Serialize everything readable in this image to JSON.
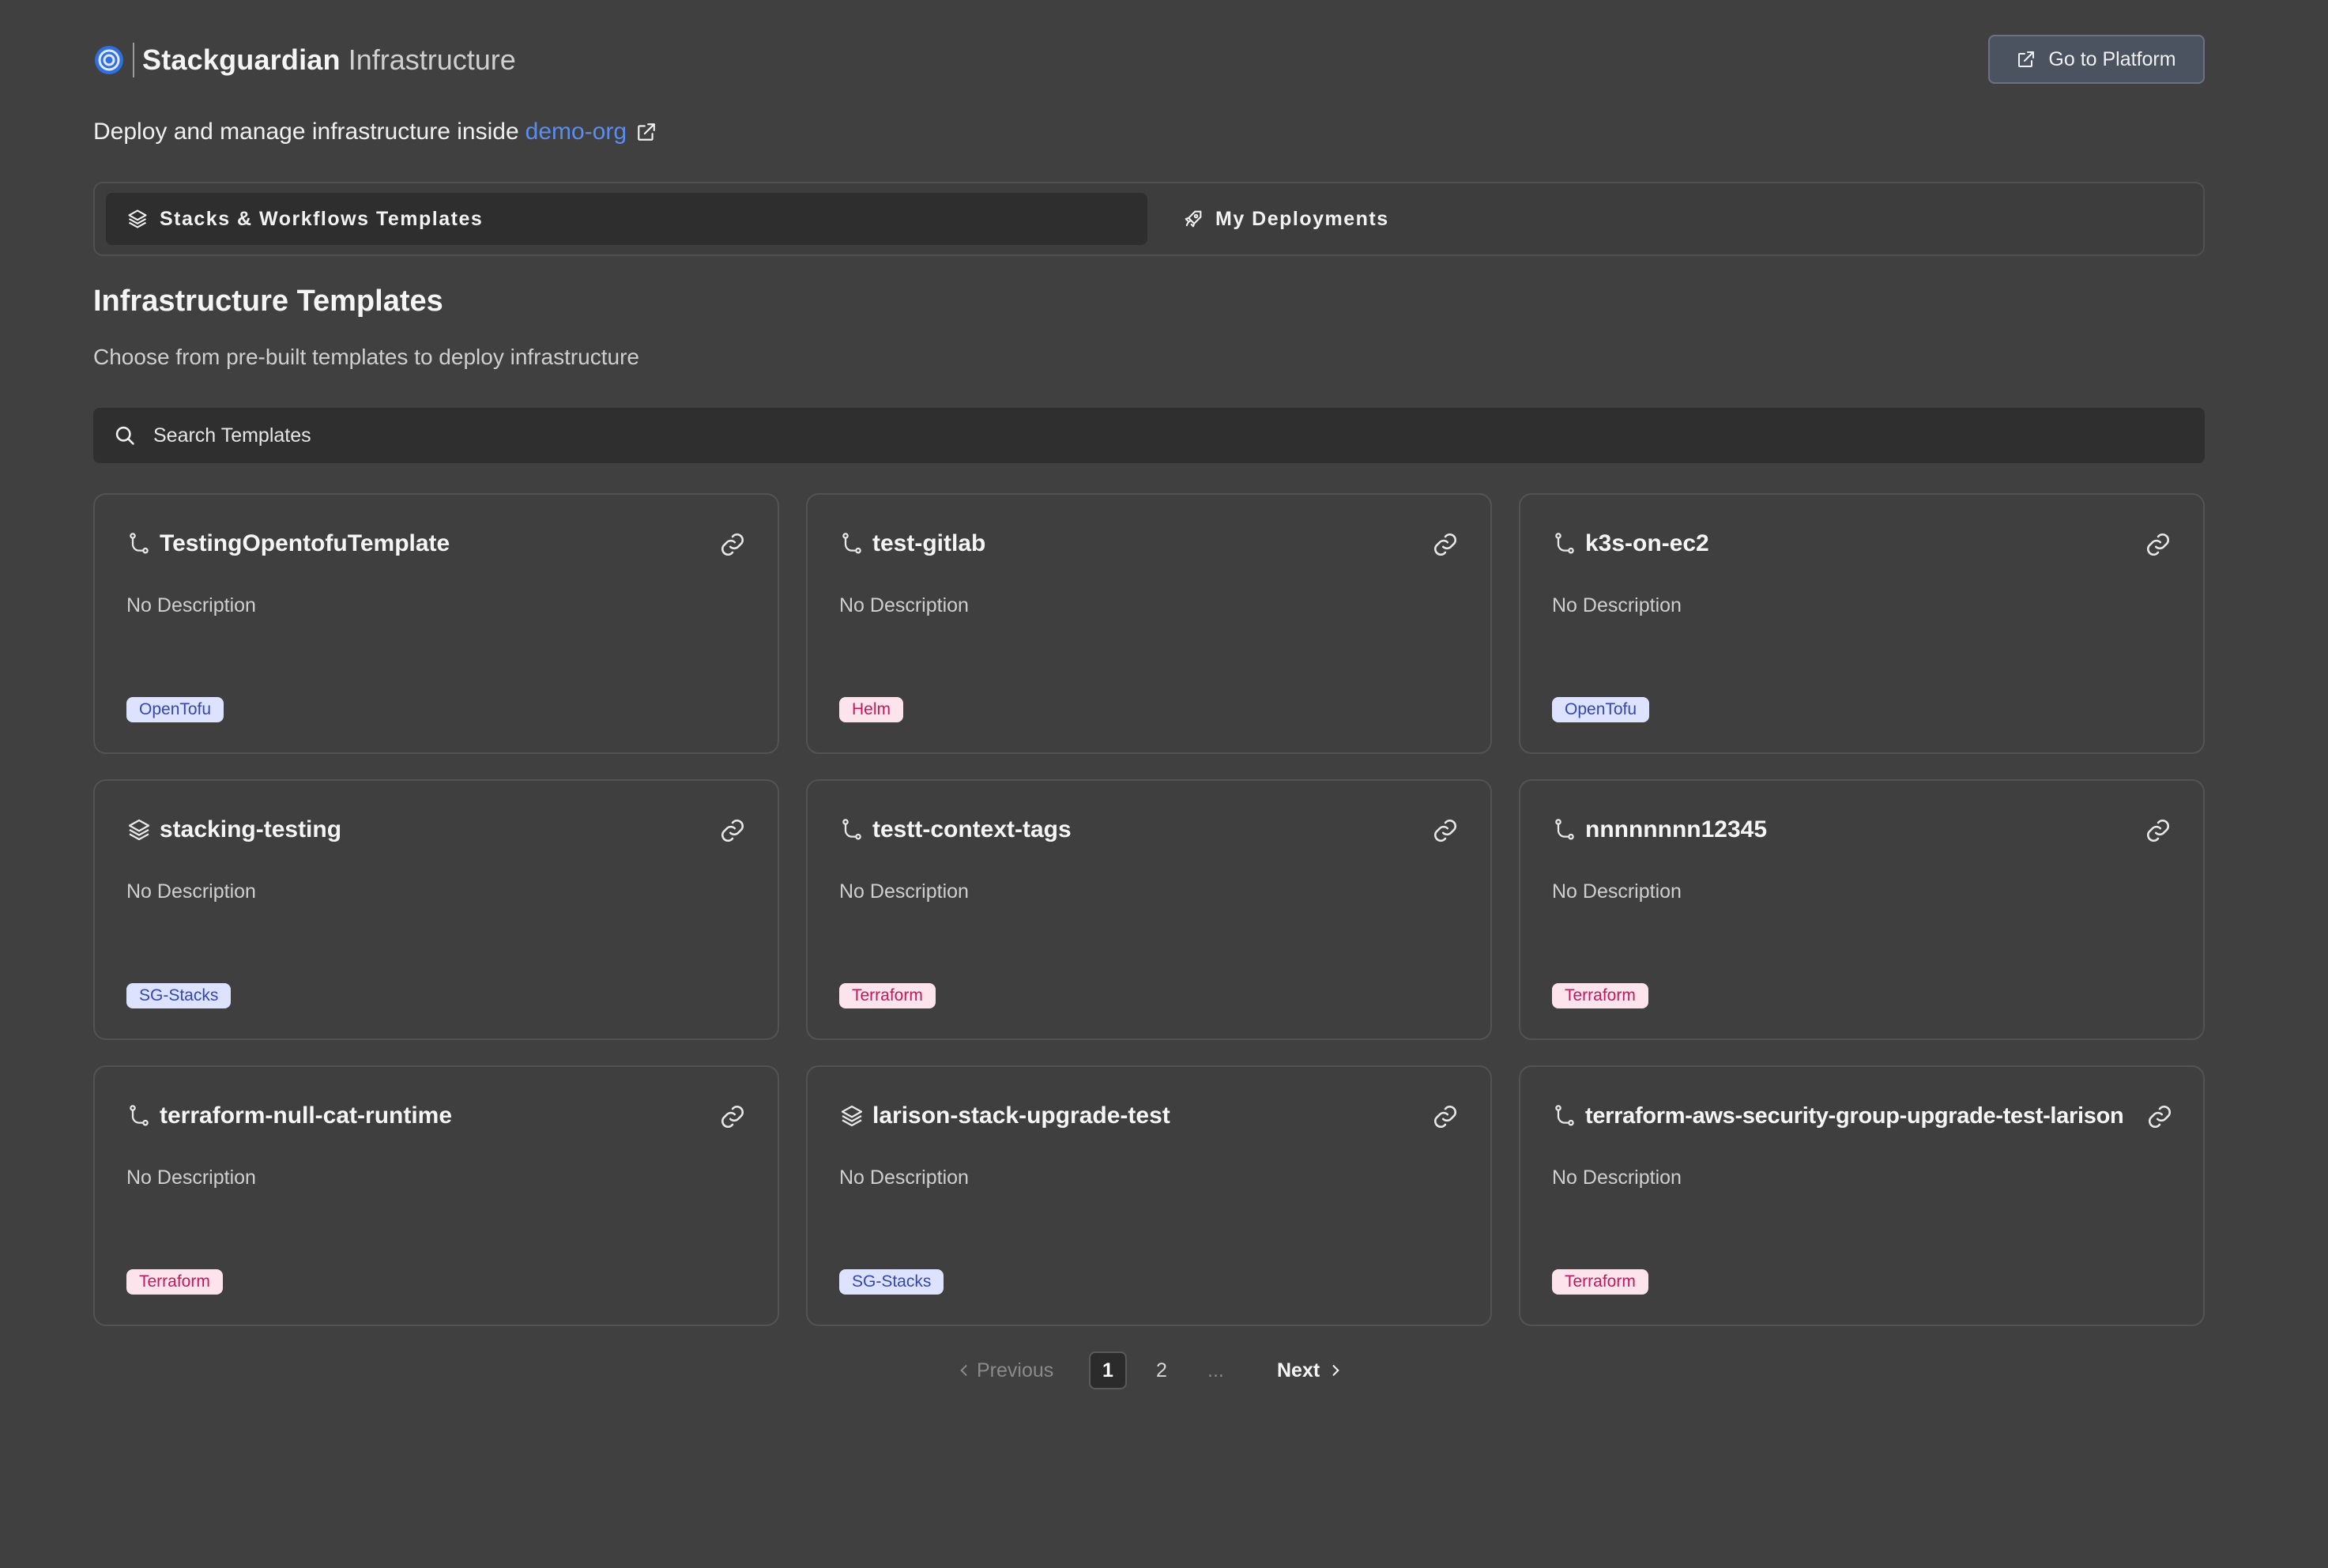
{
  "header": {
    "brand_name": "Stackguardian",
    "brand_sub": "Infrastructure",
    "platform_button": "Go to Platform"
  },
  "intro": {
    "text": "Deploy and manage infrastructure inside",
    "org_link": "demo-org"
  },
  "tabs": [
    {
      "label": "Stacks & Workflows Templates",
      "active": true
    },
    {
      "label": "My Deployments",
      "active": false
    }
  ],
  "section": {
    "title": "Infrastructure Templates",
    "description": "Choose from pre-built templates to deploy infrastructure"
  },
  "search": {
    "placeholder": "Search Templates"
  },
  "cards": [
    {
      "title": "TestingOpentofuTemplate",
      "description": "No Description",
      "badge": "OpenTofu",
      "icon": "branch-icon"
    },
    {
      "title": "test-gitlab",
      "description": "No Description",
      "badge": "Helm",
      "icon": "branch-icon"
    },
    {
      "title": "k3s-on-ec2",
      "description": "No Description",
      "badge": "OpenTofu",
      "icon": "branch-icon"
    },
    {
      "title": "stacking-testing",
      "description": "No Description",
      "badge": "SG-Stacks",
      "icon": "layers-icon"
    },
    {
      "title": "testt-context-tags",
      "description": "No Description",
      "badge": "Terraform",
      "icon": "branch-icon"
    },
    {
      "title": "nnnnnnnn12345",
      "description": "No Description",
      "badge": "Terraform",
      "icon": "branch-icon"
    },
    {
      "title": "terraform-null-cat-runtime",
      "description": "No Description",
      "badge": "Terraform",
      "icon": "branch-icon"
    },
    {
      "title": "larison-stack-upgrade-test",
      "description": "No Description",
      "badge": "SG-Stacks",
      "icon": "layers-icon"
    },
    {
      "title": "terraform-aws-security-group-upgrade-test-larison",
      "description": "No Description",
      "badge": "Terraform",
      "icon": "branch-icon"
    }
  ],
  "pagination": {
    "previous": "Previous",
    "pages": [
      "1",
      "2"
    ],
    "ellipsis": "...",
    "next": "Next",
    "current": "1"
  },
  "colors": {
    "background": "#404040",
    "link": "#5b8def",
    "badge_blue_bg": "#dde3ff",
    "badge_pink_bg": "#fde3ec"
  }
}
